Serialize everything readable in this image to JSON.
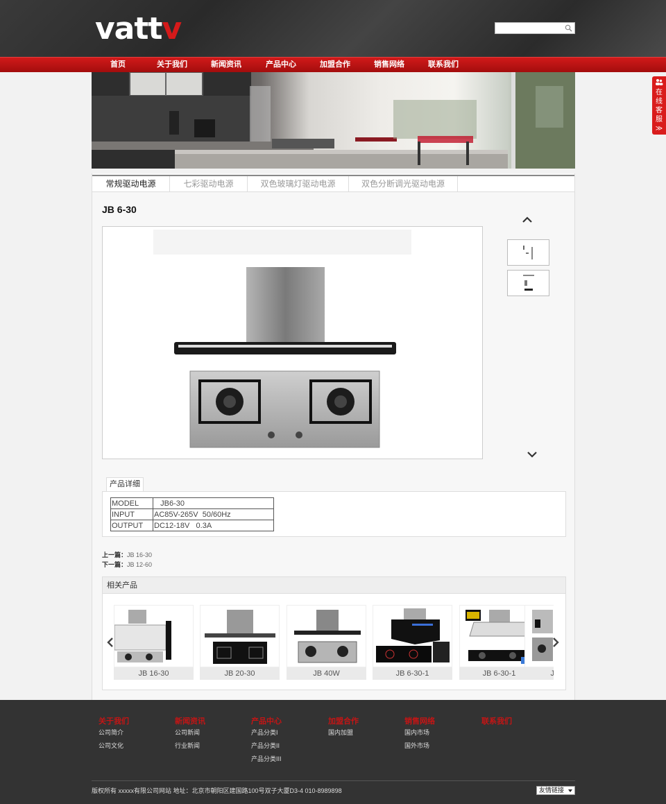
{
  "header": {
    "logo_main": "vatt",
    "logo_accent": "v",
    "search": {
      "value": "",
      "placeholder": ""
    }
  },
  "nav": {
    "items": [
      {
        "label": "首页"
      },
      {
        "label": "关于我们"
      },
      {
        "label": "新闻资讯"
      },
      {
        "label": "产品中心"
      },
      {
        "label": "加盟合作"
      },
      {
        "label": "销售网络"
      },
      {
        "label": "联系我们"
      }
    ]
  },
  "tabs": [
    {
      "label": "常规驱动电源",
      "active": true
    },
    {
      "label": "七彩驱动电源"
    },
    {
      "label": "双色玻璃灯驱动电源"
    },
    {
      "label": "双色分断调光驱动电源"
    }
  ],
  "product": {
    "title": "JB 6-30",
    "detail_tab": "产品详细",
    "specs": [
      {
        "key": "MODEL",
        "value": "   JB6-30"
      },
      {
        "key": "INPUT",
        "value": "AC85V-265V  50/60Hz"
      },
      {
        "key": "OUTPUT",
        "value": "DC12-18V   0.3A"
      }
    ],
    "prev_label": "上一篇：",
    "prev_value": "JB 16-30",
    "next_label": "下一篇：",
    "next_value": "JB 12-60"
  },
  "related": {
    "title": "相关产品",
    "items": [
      {
        "label": "JB 16-30"
      },
      {
        "label": "JB 20-30"
      },
      {
        "label": "JB 40W"
      },
      {
        "label": "JB 6-30-1"
      },
      {
        "label": "JB 6-30-1"
      },
      {
        "label": "J"
      }
    ]
  },
  "footer": {
    "columns": [
      {
        "title": "关于我们",
        "links": [
          "公司简介",
          "公司文化"
        ]
      },
      {
        "title": "新闻资讯",
        "links": [
          "公司新闻",
          "行业新闻"
        ]
      },
      {
        "title": "产品中心",
        "links": [
          "产品分类I",
          "产品分类II",
          "产品分类III"
        ]
      },
      {
        "title": "加盟合作",
        "links": [
          "国内加盟"
        ]
      },
      {
        "title": "销售网络",
        "links": [
          "国内市场",
          "国外市场"
        ]
      },
      {
        "title": "联系我们",
        "links": []
      }
    ],
    "copyright": "版权所有 xxxxx有限公司网站 地址：北京市朝阳区建国路100号双子大厦D3-4 010-8989898",
    "friend_links": "友情链接"
  },
  "side_service": {
    "label": "在线客服",
    "arrow": "≫"
  },
  "colors": {
    "brand_red": "#d11a1a",
    "header_dark": "#333333"
  }
}
